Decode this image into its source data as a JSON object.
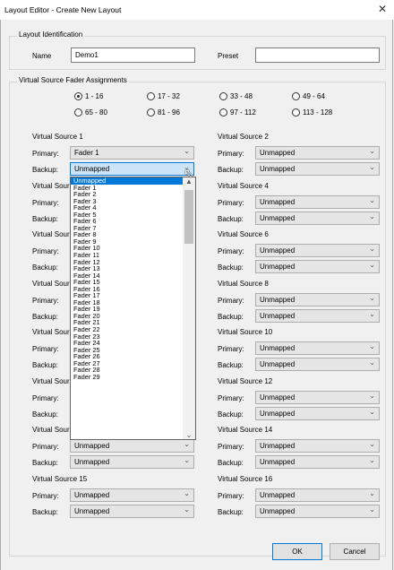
{
  "window": {
    "title": "Layout Editor - Create New Layout",
    "close_glyph": "✕"
  },
  "identification": {
    "group_label": "Layout Identification",
    "name_label": "Name",
    "name_value": "Demo1",
    "preset_label": "Preset",
    "preset_value": ""
  },
  "assignments": {
    "group_label": "Virtual Source Fader Assignments",
    "ranges": [
      {
        "label": "1 - 16",
        "selected": true
      },
      {
        "label": "17 - 32",
        "selected": false
      },
      {
        "label": "33 - 48",
        "selected": false
      },
      {
        "label": "49 - 64",
        "selected": false
      },
      {
        "label": "65 - 80",
        "selected": false
      },
      {
        "label": "81 - 96",
        "selected": false
      },
      {
        "label": "97 - 112",
        "selected": false
      },
      {
        "label": "113 - 128",
        "selected": false
      }
    ],
    "primary_label": "Primary:",
    "backup_label": "Backup:",
    "sources": [
      {
        "title": "Virtual Source 1",
        "primary": "Fader 1",
        "backup": "Unmapped"
      },
      {
        "title": "Virtual Source 2",
        "primary": "Unmapped",
        "backup": "Unmapped"
      },
      {
        "title": "Virtual Sour",
        "primary": "",
        "backup": ""
      },
      {
        "title": "Virtual Source 4",
        "primary": "Unmapped",
        "backup": "Unmapped"
      },
      {
        "title": "Virtual Sour",
        "primary": "",
        "backup": ""
      },
      {
        "title": "Virtual Source 6",
        "primary": "Unmapped",
        "backup": "Unmapped"
      },
      {
        "title": "Virtual Sour",
        "primary": "",
        "backup": ""
      },
      {
        "title": "Virtual Source 8",
        "primary": "Unmapped",
        "backup": "Unmapped"
      },
      {
        "title": "Virtual Sour",
        "primary": "",
        "backup": ""
      },
      {
        "title": "Virtual Source 10",
        "primary": "Unmapped",
        "backup": "Unmapped"
      },
      {
        "title": "Virtual Sour",
        "primary": "",
        "backup": ""
      },
      {
        "title": "Virtual Source 12",
        "primary": "Unmapped",
        "backup": "Unmapped"
      },
      {
        "title": "Virtual Sour",
        "primary": "Unmapped",
        "backup": "Unmapped"
      },
      {
        "title": "Virtual Source 14",
        "primary": "Unmapped",
        "backup": "Unmapped"
      },
      {
        "title": "Virtual Source 15",
        "primary": "Unmapped",
        "backup": "Unmapped"
      },
      {
        "title": "Virtual Source 16",
        "primary": "Unmapped",
        "backup": "Unmapped"
      }
    ]
  },
  "dropdown": {
    "selected": "Unmapped",
    "items": [
      "Unmapped",
      "Fader 1",
      "Fader 2",
      "Fader 3",
      "Fader 4",
      "Fader 5",
      "Fader 6",
      "Fader 7",
      "Fader 8",
      "Fader 9",
      "Fader 10",
      "Fader 11",
      "Fader 12",
      "Fader 13",
      "Fader 14",
      "Fader 15",
      "Fader 16",
      "Fader 17",
      "Fader 18",
      "Fader 19",
      "Fader 20",
      "Fader 21",
      "Fader 22",
      "Fader 23",
      "Fader 24",
      "Fader 25",
      "Fader 26",
      "Fader 27",
      "Fader 28",
      "Fader 29"
    ]
  },
  "buttons": {
    "ok": "OK",
    "cancel": "Cancel"
  },
  "icons": {
    "chevron": "chevron-down-icon",
    "scroll_up": "scroll-up-icon",
    "scroll_down": "scroll-down-icon",
    "close": "close-icon"
  }
}
